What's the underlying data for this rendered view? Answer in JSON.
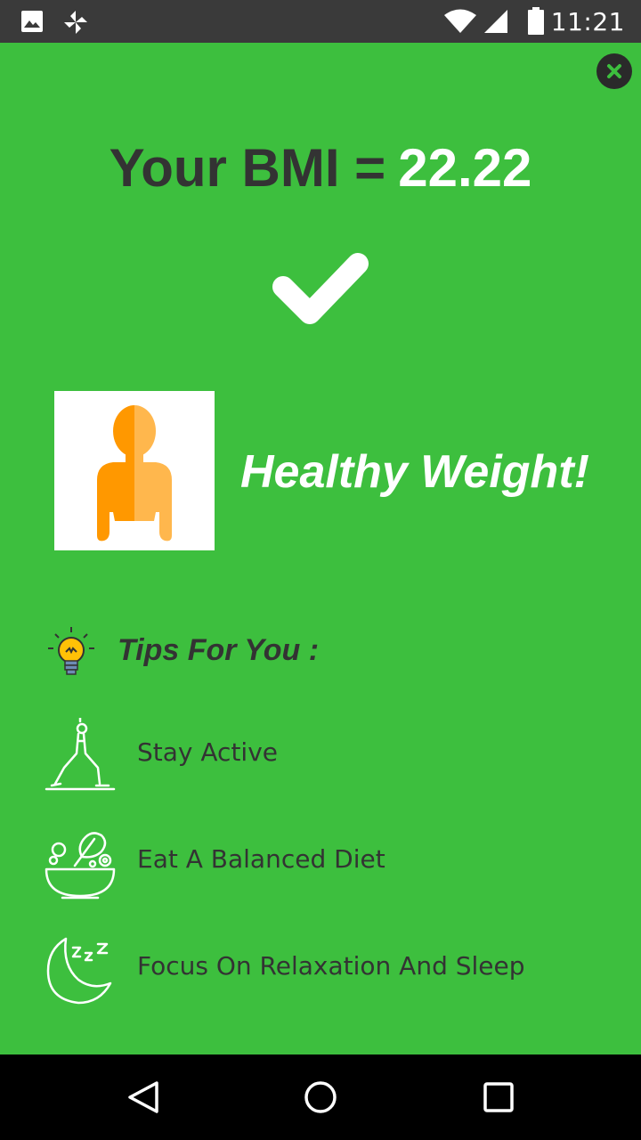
{
  "status_bar": {
    "time": "11:21",
    "icons": [
      "image-icon",
      "pinwheel-icon",
      "wifi-icon",
      "signal-icon",
      "battery-icon"
    ]
  },
  "result": {
    "title_prefix": "Your BMI =",
    "bmi_value": "22.22",
    "status": "Healthy Weight!"
  },
  "tips": {
    "title": "Tips For You :",
    "items": [
      {
        "label": "Stay Active",
        "icon": "yoga-icon"
      },
      {
        "label": "Eat A Balanced Diet",
        "icon": "salad-bowl-icon"
      },
      {
        "label": "Focus On Relaxation And Sleep",
        "icon": "moon-sleep-icon"
      }
    ]
  },
  "colors": {
    "background": "#3dbf3e",
    "status_bar": "#3a3a3a",
    "nav_bar": "#000000",
    "title_text": "#333333",
    "accent_text": "#ffffff",
    "body_light": "#ffb74d",
    "body_dark": "#ff9800"
  },
  "nav": {
    "buttons": [
      "back-icon",
      "home-icon",
      "recents-icon"
    ]
  }
}
